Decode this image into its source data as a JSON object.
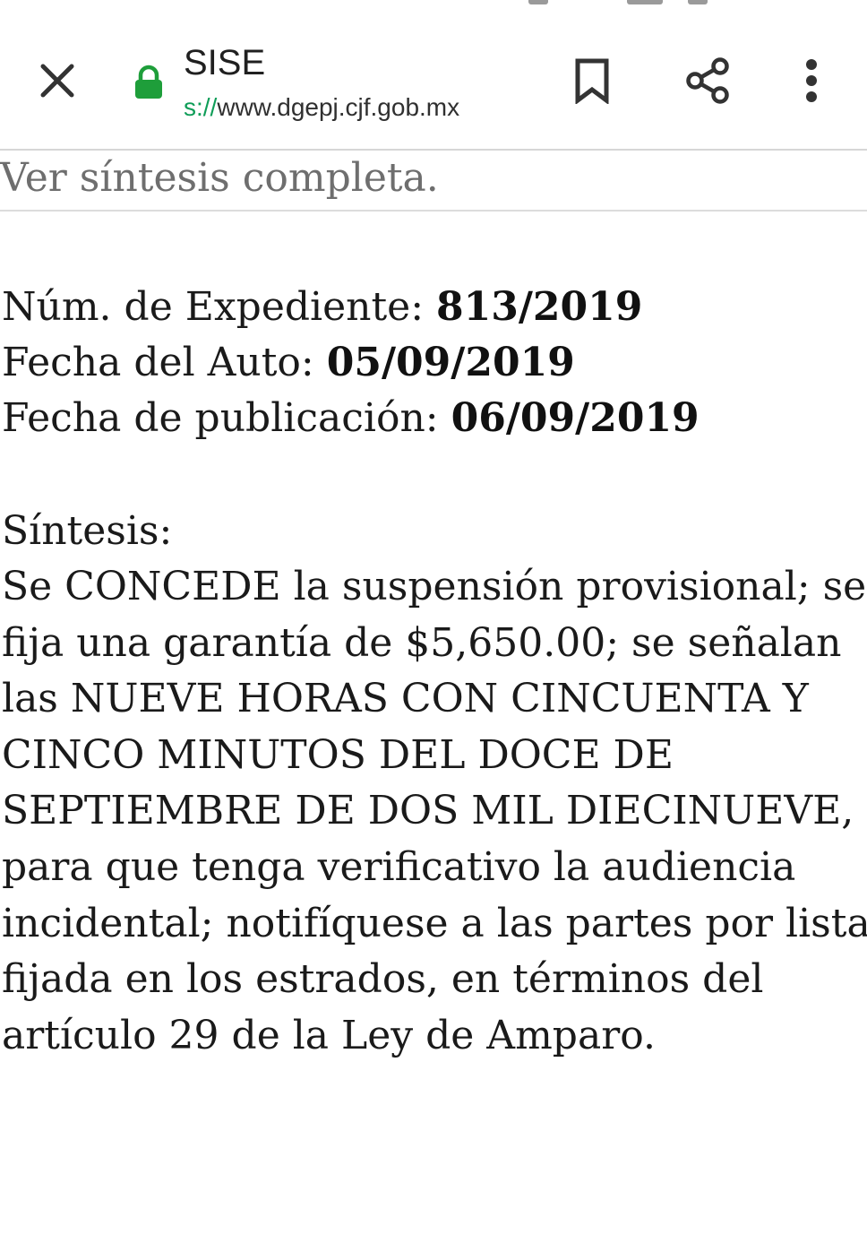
{
  "browser": {
    "title": "SISE",
    "url_scheme": "s://",
    "url_host": "www.dgepj.cjf.gob.mx",
    "secure_color": "#1e9e3a",
    "icons": {
      "close": "close-icon",
      "lock": "lock-icon",
      "bookmark": "bookmark-icon",
      "share": "share-icon",
      "menu": "more-vert-icon"
    }
  },
  "page": {
    "ver_sintesis": "Ver síntesis completa.",
    "expediente": {
      "label": "Núm. de Expediente: ",
      "value": "813/2019"
    },
    "fecha_auto": {
      "label": "Fecha del Auto: ",
      "value": "05/09/2019"
    },
    "fecha_publicacion": {
      "label": "Fecha de publicación: ",
      "value": "06/09/2019"
    },
    "sintesis_label": "Síntesis:",
    "sintesis_lines": [
      "Se CONCEDE la suspensión provisional; se",
      "fija una garantía de $5,650.00; se señalan",
      "las NUEVE HORAS CON CINCUENTA Y",
      "CINCO MINUTOS DEL DOCE DE",
      "SEPTIEMBRE DE DOS MIL DIECINUEVE,",
      "para que tenga verificativo la audiencia",
      "incidental; notifíquese a las partes por lista",
      "fijada en los estrados, en términos del",
      "artículo 29 de la Ley de Amparo."
    ]
  }
}
